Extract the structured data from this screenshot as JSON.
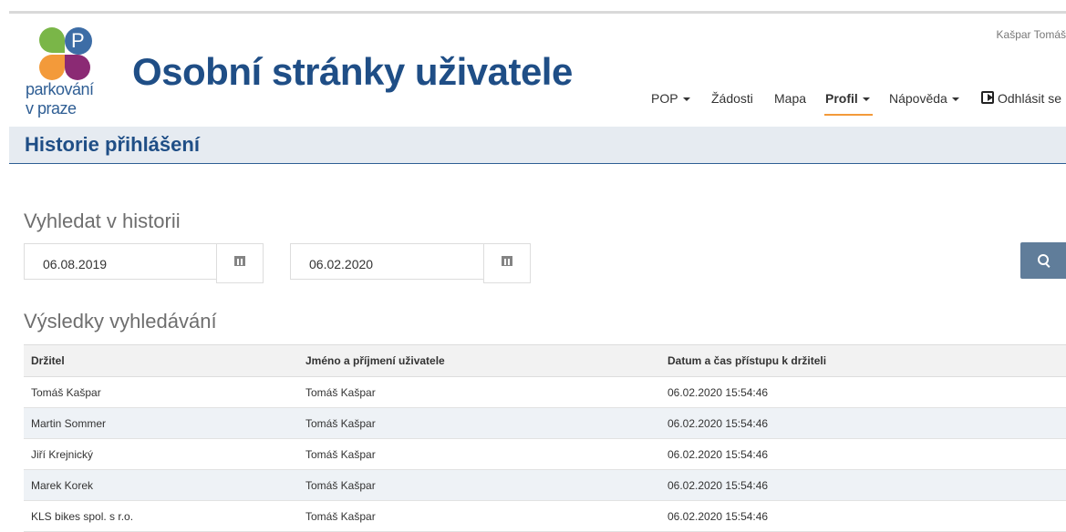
{
  "header": {
    "logo_text_line1": "parkování",
    "logo_text_line2": "v praze",
    "logo_letter": "P",
    "title": "Osobní stránky uživatele",
    "user_name": "Kašpar Tomáš"
  },
  "nav": {
    "items": [
      "POP",
      "Žádosti",
      "Mapa",
      "Profil",
      "Nápověda"
    ],
    "logout": "Odhlásit se",
    "active": "Profil"
  },
  "section": {
    "title": "Historie přihlášení"
  },
  "search": {
    "heading": "Vyhledat v historii",
    "date_from": "06.08.2019",
    "date_to": "06.02.2020"
  },
  "results": {
    "heading": "Výsledky vyhledávání",
    "columns": [
      "Držitel",
      "Jméno a příjmení uživatele",
      "Datum a čas přístupu k držiteli"
    ],
    "rows": [
      [
        "Tomáš Kašpar",
        "Tomáš Kašpar",
        "06.02.2020 15:54:46"
      ],
      [
        "Martin Sommer",
        "Tomáš Kašpar",
        "06.02.2020 15:54:46"
      ],
      [
        "Jiří Krejnický",
        "Tomáš Kašpar",
        "06.02.2020 15:54:46"
      ],
      [
        "Marek Korek",
        "Tomáš Kašpar",
        "06.02.2020 15:54:46"
      ],
      [
        "KLS bikes spol. s r.o.",
        "Tomáš Kašpar",
        "06.02.2020 15:54:46"
      ]
    ]
  },
  "colors": {
    "brand": "#1f4e86",
    "accent": "#f39a3a",
    "button": "#607d9a"
  }
}
